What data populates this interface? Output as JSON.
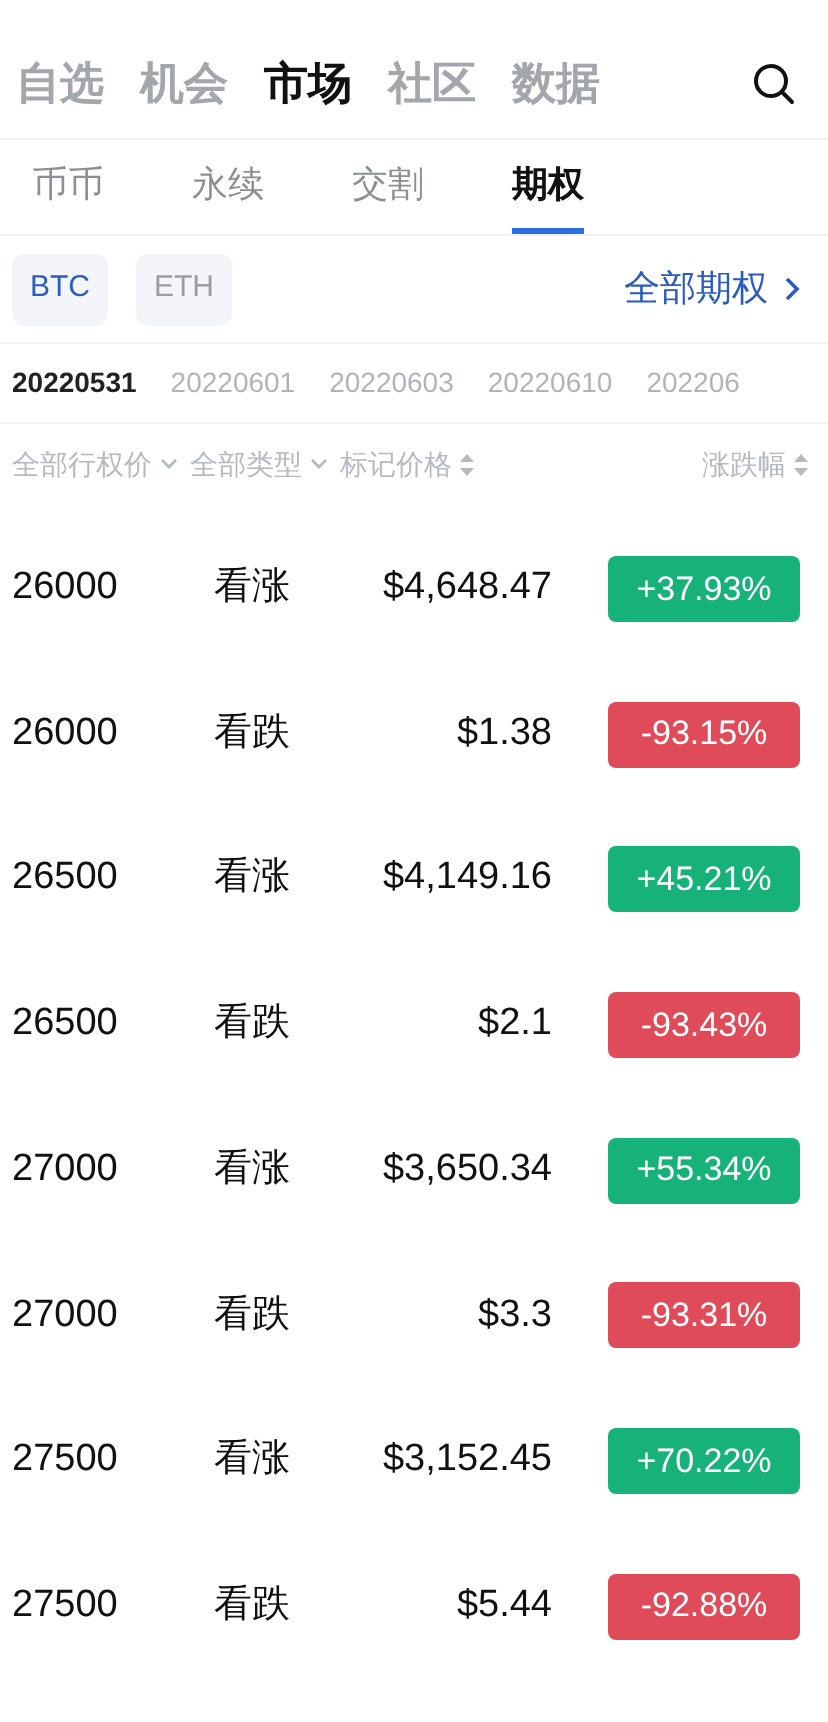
{
  "main_tabs": [
    {
      "label": "自选",
      "selected": false
    },
    {
      "label": "机会",
      "selected": false
    },
    {
      "label": "市场",
      "selected": true
    },
    {
      "label": "社区",
      "selected": false
    },
    {
      "label": "数据",
      "selected": false
    }
  ],
  "sub_tabs": [
    {
      "label": "币币",
      "selected": false
    },
    {
      "label": "永续",
      "selected": false
    },
    {
      "label": "交割",
      "selected": false
    },
    {
      "label": "期权",
      "selected": true
    }
  ],
  "coins": [
    {
      "label": "BTC",
      "selected": true
    },
    {
      "label": "ETH",
      "selected": false
    }
  ],
  "all_options_link": "全部期权",
  "dates": [
    {
      "label": "20220531",
      "selected": true
    },
    {
      "label": "20220601",
      "selected": false
    },
    {
      "label": "20220603",
      "selected": false
    },
    {
      "label": "20220610",
      "selected": false
    },
    {
      "label": "202206",
      "selected": false
    }
  ],
  "columns": [
    {
      "label": "全部行权价",
      "kind": "dropdown"
    },
    {
      "label": "全部类型",
      "kind": "dropdown"
    },
    {
      "label": "标记价格",
      "kind": "sort"
    },
    {
      "label": "涨跌幅",
      "kind": "sort"
    }
  ],
  "rows": [
    {
      "strike": "26000",
      "type": "看涨",
      "price": "$4,648.47",
      "change": "+37.93%",
      "color": "#16b27a"
    },
    {
      "strike": "26000",
      "type": "看跌",
      "price": "$1.38",
      "change": "-93.15%",
      "color": "#e04b5a"
    },
    {
      "strike": "26500",
      "type": "看涨",
      "price": "$4,149.16",
      "change": "+45.21%",
      "color": "#16b27a"
    },
    {
      "strike": "26500",
      "type": "看跌",
      "price": "$2.1",
      "change": "-93.43%",
      "color": "#e04b5a"
    },
    {
      "strike": "27000",
      "type": "看涨",
      "price": "$3,650.34",
      "change": "+55.34%",
      "color": "#16b27a"
    },
    {
      "strike": "27000",
      "type": "看跌",
      "price": "$3.3",
      "change": "-93.31%",
      "color": "#e04b5a"
    },
    {
      "strike": "27500",
      "type": "看涨",
      "price": "$3,152.45",
      "change": "+70.22%",
      "color": "#16b27a"
    },
    {
      "strike": "27500",
      "type": "看跌",
      "price": "$5.44",
      "change": "-92.88%",
      "color": "#e04b5a"
    }
  ]
}
